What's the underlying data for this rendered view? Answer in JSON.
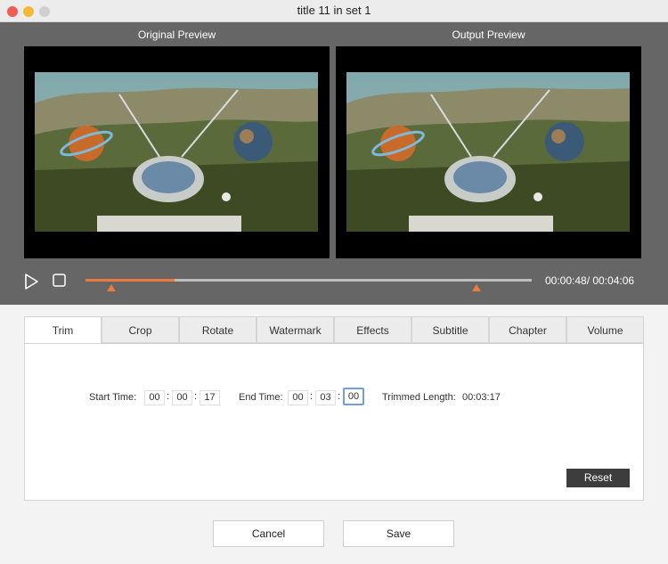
{
  "window": {
    "title": "title 11 in set 1"
  },
  "preview": {
    "original_label": "Original Preview",
    "output_label": "Output  Preview",
    "time_display": "00:00:48/ 00:04:06",
    "progress_fraction": 0.2,
    "accent_color": "#f07a3a"
  },
  "tabs": [
    {
      "label": "Trim",
      "active": true
    },
    {
      "label": "Crop"
    },
    {
      "label": "Rotate"
    },
    {
      "label": "Watermark"
    },
    {
      "label": "Effects"
    },
    {
      "label": "Subtitle"
    },
    {
      "label": "Chapter"
    },
    {
      "label": "Volume"
    }
  ],
  "trim": {
    "start_label": "Start Time:",
    "start": [
      "00",
      "00",
      "17"
    ],
    "end_label": "End Time:",
    "end": [
      "00",
      "03",
      "00"
    ],
    "trimmed_label": "Trimmed Length:",
    "trimmed_value": "00:03:17",
    "reset_label": "Reset"
  },
  "actions": {
    "cancel_label": "Cancel",
    "save_label": "Save"
  }
}
